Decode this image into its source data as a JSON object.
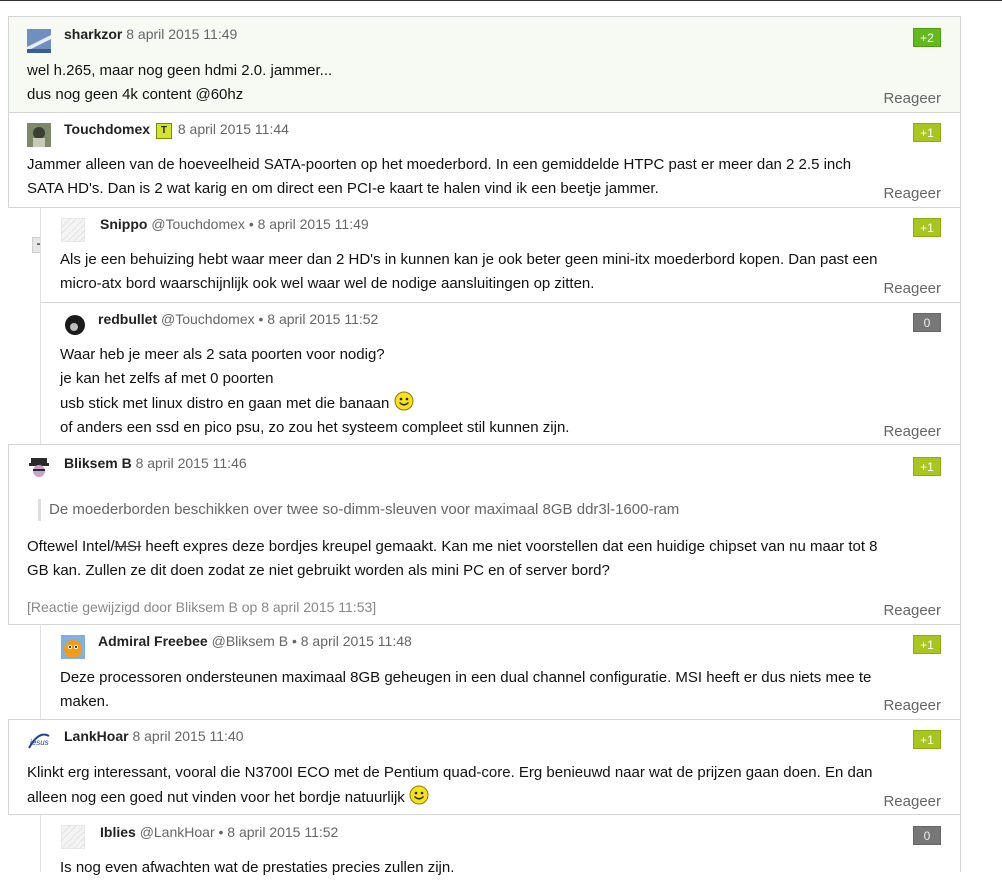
{
  "comments": [
    {
      "user": "sharkzor",
      "time": "8 april 2015 11:49",
      "score": "+2",
      "lines": [
        "wel h.265, maar nog geen hdmi 2.0. jammer...",
        "dus nog geen 4k content @60hz"
      ],
      "reply_label": "Reageer"
    },
    {
      "user": "Touchdomex",
      "badge": "T",
      "time": "8 april 2015 11:44",
      "score": "+1",
      "lines": [
        "Jammer alleen van de hoeveelheid SATA-poorten op het moederbord. In een gemiddelde HTPC past er meer dan 2 2.5 inch",
        "SATA HD's. Dan is 2 wat karig en om direct een PCI-e kaart te halen vind ik een beetje jammer."
      ],
      "reply_label": "Reageer",
      "replies": [
        {
          "user": "Snippo",
          "at": "@Touchdomex",
          "dot": "•",
          "time": "8 april 2015 11:49",
          "score": "+1",
          "lines": [
            "Als je een behuizing hebt waar meer dan 2 HD's in kunnen kan je ook beter geen mini-itx moederbord kopen. Dan past een",
            "micro-atx bord waarschijnlijk ook wel waar wel de nodige aansluitingen op zitten."
          ],
          "reply_label": "Reageer"
        },
        {
          "user": "redbullet",
          "at": "@Touchdomex",
          "dot": "•",
          "time": "8 april 2015 11:52",
          "score": "0",
          "lines": [
            "Waar heb je meer als 2 sata poorten voor nodig?",
            "je kan het zelfs af met 0 poorten",
            "usb stick met linux distro en gaan met die banaan",
            "of anders een ssd en pico psu, zo zou het systeem compleet stil kunnen zijn."
          ],
          "reply_label": "Reageer"
        }
      ]
    },
    {
      "user": "Bliksem B",
      "time": "8 april 2015 11:46",
      "score": "+1",
      "quote": "De moederborden beschikken over twee so-dimm-sleuven voor maximaal 8GB ddr3l-1600-ram",
      "lines_pre": "Oftewel Intel/",
      "strike": "MSI",
      "lines_post": " heeft expres deze bordjes kreupel gemaakt. Kan me niet voorstellen dat een huidige chipset van nu maar tot 8",
      "line2": "GB kan. Zullen ze dit doen zodat ze niet gebruikt worden als mini PC en of server bord?",
      "edited": "[Reactie gewijzigd door Bliksem B op 8 april 2015 11:53]",
      "reply_label": "Reageer",
      "replies": [
        {
          "user": "Admiral Freebee",
          "at": "@Bliksem B",
          "dot": "•",
          "time": "8 april 2015 11:48",
          "score": "+1",
          "lines": [
            "Deze processoren ondersteunen maximaal 8GB geheugen in een dual channel configuratie. MSI heeft er dus niets mee te",
            "maken."
          ],
          "reply_label": "Reageer"
        }
      ]
    },
    {
      "user": "LankHoar",
      "time": "8 april 2015 11:40",
      "score": "+1",
      "lines": [
        "Klinkt erg interessant, vooral die N3700I ECO met de Pentium quad-core. Erg benieuwd naar wat de prijzen gaan doen. En dan",
        "alleen nog een goed nut vinden voor het bordje natuurlijk"
      ],
      "reply_label": "Reageer",
      "replies": [
        {
          "user": "Iblies",
          "at": "@LankHoar",
          "dot": "•",
          "time": "8 april 2015 11:52",
          "score": "0",
          "lines": [
            "Is nog even afwachten wat de prestaties precies zullen zijn."
          ],
          "reply_label": "Reageer"
        }
      ]
    }
  ],
  "collapse_symbol": "−",
  "icons": [
    "smiley-icon",
    "collapse-icon",
    "avatar-icon"
  ],
  "colors": {
    "score_plus1": "#a8c61e",
    "score_plus2": "#62bb1c",
    "score_zero": "#777777",
    "highlight_bg": "#f6faf3"
  }
}
